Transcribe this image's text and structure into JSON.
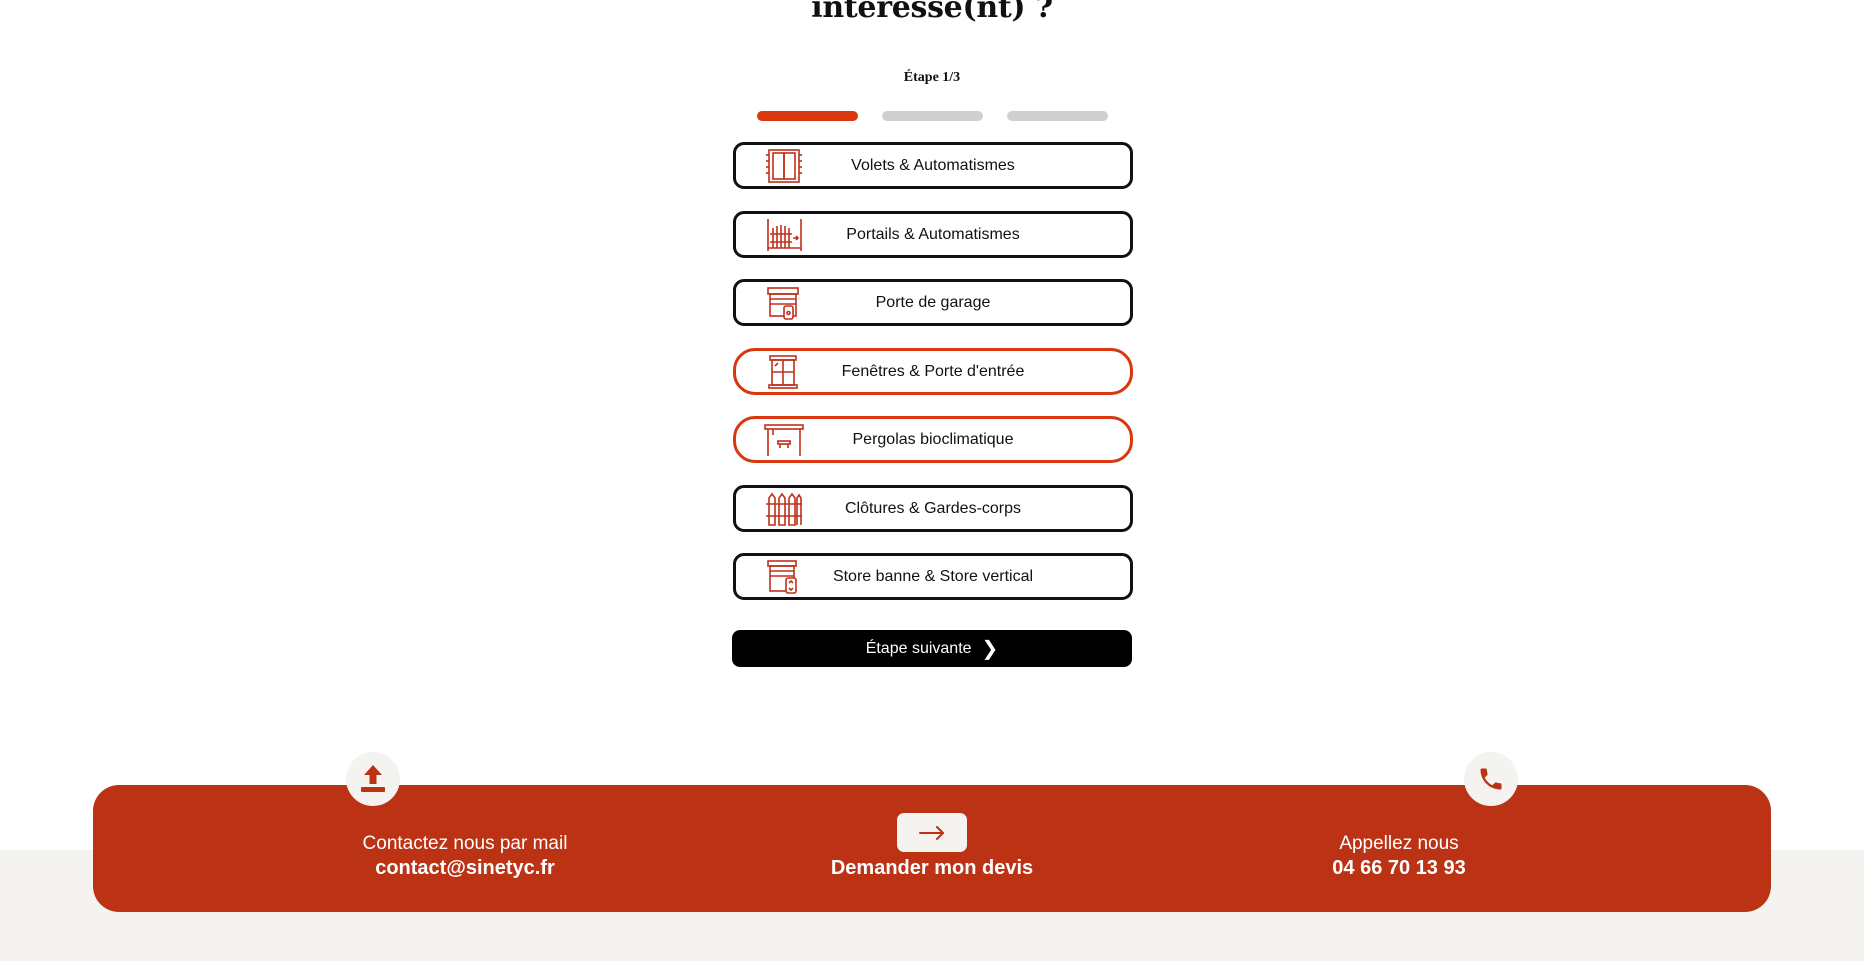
{
  "heading": {
    "title": "intéresse(nt) ?",
    "step": "Étape 1/3",
    "progress": {
      "current": 1,
      "total": 3
    }
  },
  "options": [
    {
      "label": "Volets & Automatismes",
      "icon": "shutter-icon",
      "selected": false
    },
    {
      "label": "Portails & Automatismes",
      "icon": "gate-icon",
      "selected": false
    },
    {
      "label": "Porte de garage",
      "icon": "garage-door-icon",
      "selected": false
    },
    {
      "label": "Fenêtres & Porte d'entrée",
      "icon": "window-icon",
      "selected": true
    },
    {
      "label": "Pergolas bioclimatique",
      "icon": "pergola-icon",
      "selected": true
    },
    {
      "label": "Clôtures & Gardes-corps",
      "icon": "fence-icon",
      "selected": false
    },
    {
      "label": "Store banne & Store vertical",
      "icon": "awning-icon",
      "selected": false
    }
  ],
  "next_button": {
    "label": "Étape suivante",
    "icon": "chevron-right-icon"
  },
  "contact": {
    "mail": {
      "label": "Contactez nous par mail",
      "value": "contact@sinetyc.fr",
      "icon": "upload-icon"
    },
    "quote": {
      "label": "Demander mon devis",
      "icon": "arrow-right-icon"
    },
    "phone": {
      "label": "Appellez nous",
      "value": "04 66 70 13 93",
      "icon": "phone-icon"
    }
  },
  "colors": {
    "accent": "#d9370d",
    "bar": "#bb3215",
    "inactive": "#cfcfcf",
    "cream": "#f5f3ef"
  }
}
